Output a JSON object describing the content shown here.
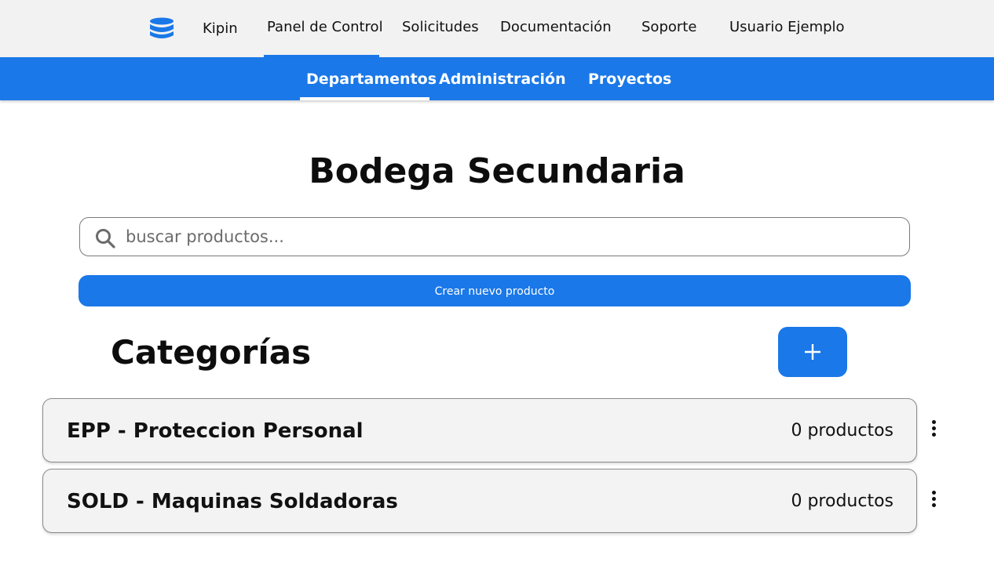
{
  "topnav": {
    "brand": "Kipin",
    "items": [
      {
        "label": "Panel de Control",
        "active": true
      },
      {
        "label": "Solicitudes",
        "active": false
      },
      {
        "label": "Documentación",
        "active": false
      },
      {
        "label": "Soporte",
        "active": false
      },
      {
        "label": "Usuario Ejemplo",
        "active": false
      }
    ],
    "logo_icon": "database-icon",
    "logo_color": "#1a78e8"
  },
  "subnav": {
    "items": [
      {
        "label": "Departamentos",
        "active": true
      },
      {
        "label": "Administración",
        "active": false
      },
      {
        "label": "Proyectos",
        "active": false
      }
    ]
  },
  "page": {
    "title": "Bodega Secundaria"
  },
  "search": {
    "placeholder": "buscar productos...",
    "value": "",
    "icon": "search-icon"
  },
  "actions": {
    "create_product_label": "Crear nuevo producto",
    "add_category_icon": "plus-icon"
  },
  "categories": {
    "title": "Categorías",
    "items": [
      {
        "name": "EPP - Proteccion Personal",
        "count": "0 productos"
      },
      {
        "name": "SOLD - Maquinas Soldadoras",
        "count": "0 productos"
      }
    ]
  },
  "colors": {
    "accent": "#1a78e8",
    "topnav_bg": "#f2f2f2",
    "card_bg": "#f3f3f3"
  }
}
